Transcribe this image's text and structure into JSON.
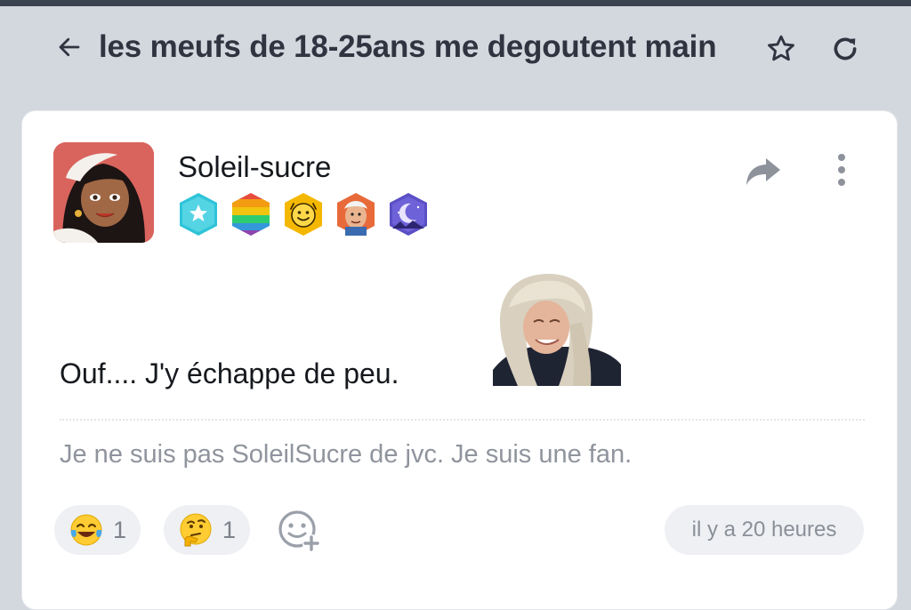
{
  "header": {
    "title": "les meufs de 18-25ans me degoutent main",
    "back_icon": "arrow-left-icon",
    "favorite_icon": "star-outline-icon",
    "refresh_icon": "refresh-icon"
  },
  "post": {
    "author": "Soleil-sucre",
    "avatar_icon": "cartoon-princess-avatar",
    "badges": [
      {
        "name": "star-badge",
        "color": "#2ec4d8"
      },
      {
        "name": "rainbow-badge",
        "color": "#f0a030"
      },
      {
        "name": "smiley-badge",
        "color": "#f5b800"
      },
      {
        "name": "meme-face-badge",
        "color": "#e86a3a"
      },
      {
        "name": "moon-night-badge",
        "color": "#5a4fc4"
      }
    ],
    "message": "Ouf.... J'y échappe de peu.",
    "sticker_icon": "smiling-woman-sticker",
    "signature": "Je ne suis pas SoleilSucre de jvc. Je suis une fan.",
    "reactions": [
      {
        "emoji": "😂",
        "count": "1"
      },
      {
        "emoji": "🤔",
        "count": "1"
      }
    ],
    "timestamp": "il y a 20 heures"
  },
  "colors": {
    "page_bg": "#d3d7de",
    "card_bg": "#ffffff",
    "icon_gray": "#8d929b"
  }
}
